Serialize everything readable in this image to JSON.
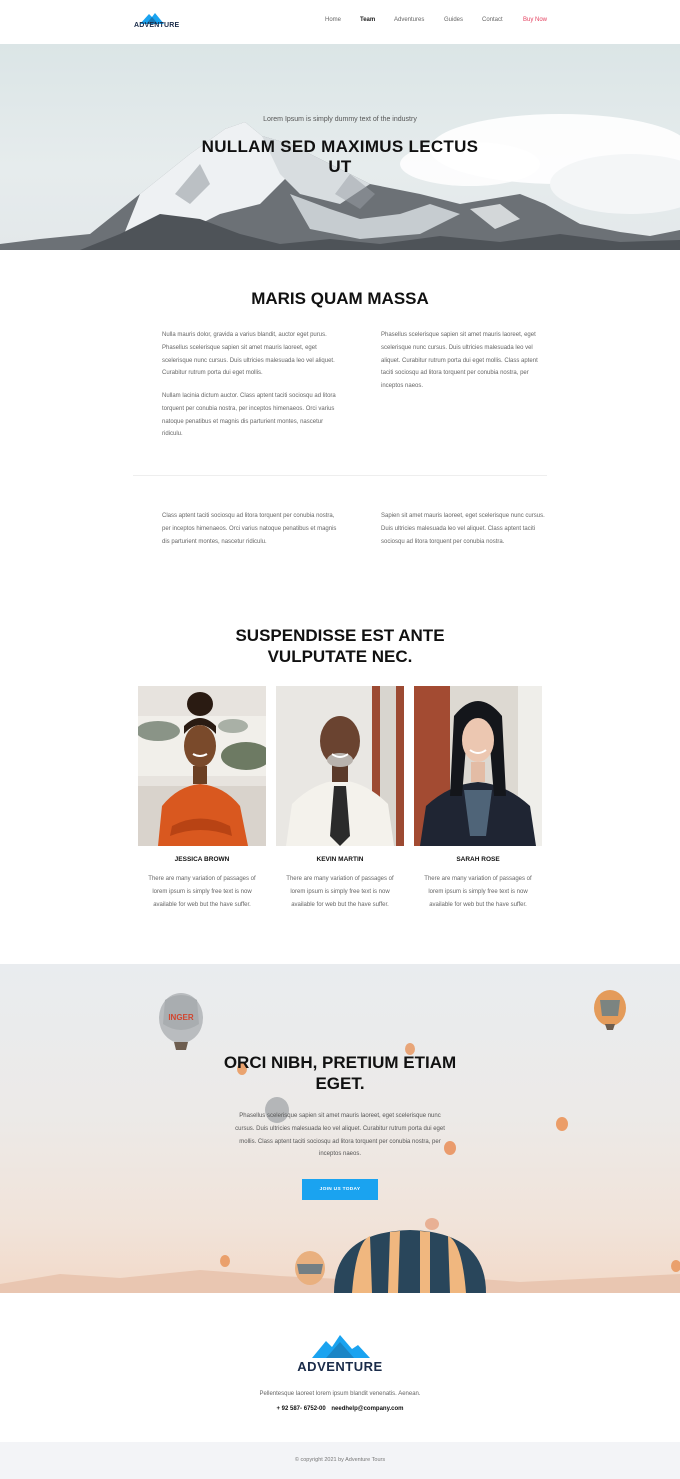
{
  "header": {
    "brand": "ADVENTURE",
    "nav": [
      "Home",
      "Team",
      "Adventures",
      "Guides",
      "Contact",
      "Buy Now"
    ]
  },
  "hero": {
    "subtitle": "Lorem Ipsum is simply dummy text of the industry",
    "title": "NULLAM SED MAXIMUS LECTUS UT"
  },
  "about": {
    "title": "MARIS QUAM MASSA",
    "col1_p1": "Nulla mauris dolor, gravida a varius blandit, auctor eget purus. Phasellus scelerisque sapien sit amet mauris laoreet, eget scelerisque nunc cursus. Duis ultricies malesuada leo vel aliquet. Curabitur rutrum porta dui eget mollis.",
    "col1_p2": "Nullam lacinia dictum auctor. Class aptent taciti sociosqu ad litora torquent per conubia nostra, per inceptos himenaeos. Orci varius natoque penatibus et magnis dis parturient montes, nascetur ridiculu.",
    "col2_p1": "Phasellus scelerisque sapien sit amet mauris laoreet, eget scelerisque nunc cursus. Duis ultricies malesuada leo vel aliquet. Curabitur rutrum porta dui eget mollis. Class aptent taciti sociosqu ad litora torquent per conubia nostra, per inceptos naeos.",
    "col1_p3": "Class aptent taciti sociosqu ad litora torquent per conubia nostra, per inceptos himenaeos. Orci varius natoque penatibus et magnis dis parturient montes, nascetur ridiculu.",
    "col2_p2": "Sapien sit amet mauris laoreet, eget scelerisque nunc cursus. Duis ultricies malesuada leo vel aliquet.  Class aptent taciti sociosqu ad litora torquent per conubia nostra."
  },
  "team": {
    "title": "SUSPENDISSE EST ANTE VULPUTATE NEC.",
    "members": [
      {
        "name": "JESSICA BROWN",
        "desc": "There are many variation of passages of lorem ipsum is simply free text is now available for web but the have suffer."
      },
      {
        "name": "KEVIN MARTIN",
        "desc": "There are many variation of passages of lorem ipsum is simply free text is now available for web but the have suffer."
      },
      {
        "name": "SARAH ROSE",
        "desc": "There are many variation of passages of lorem ipsum is simply free text is now available for web but the have suffer."
      }
    ]
  },
  "cta": {
    "title": "ORCI NIBH, PRETIUM ETIAM EGET.",
    "text": "Phasellus scelerisque sapien sit amet mauris laoreet, eget scelerisque nunc cursus. Duis ultricies malesuada leo vel aliquet. Curabitur rutrum porta dui eget mollis. Class aptent taciti sociosqu ad litora torquent per conubia nostra, per inceptos naeos.",
    "button": "JOIN US TODAY",
    "balloon_text": "INGER"
  },
  "footer": {
    "brand": "ADVENTURE",
    "text": "Pellentesque laoreet lorem ipsum blandit venenatis. Aenean.",
    "phone": "+ 92 587- 6752-00",
    "email": "needhelp@company.com",
    "copyright": "© copyright 2021 by Adventure Tours"
  },
  "colors": {
    "accent": "#1aa3f0",
    "buy_now": "#e4405f",
    "brand_dark": "#1a2b49"
  }
}
